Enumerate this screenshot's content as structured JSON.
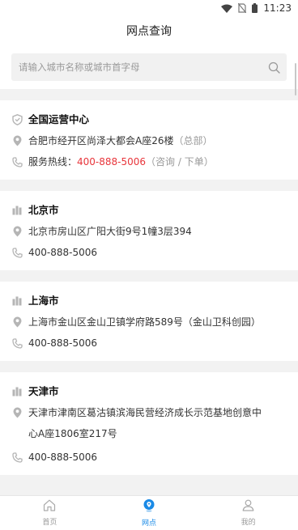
{
  "status_bar": {
    "time": "11:23",
    "icons": [
      "wifi-icon",
      "no-sim-icon",
      "battery-icon"
    ]
  },
  "header": {
    "title": "网点查询"
  },
  "search": {
    "placeholder": "请输入城市名称或城市首字母",
    "value": ""
  },
  "hq": {
    "title": "全国运营中心",
    "address": "合肥市经开区尚泽大都会A座26楼",
    "address_note": "（总部）",
    "hotline_label": "服务热线：",
    "hotline_number": "400-888-5006",
    "hotline_note": "（咨询 / 下单）"
  },
  "branches": [
    {
      "city": "北京市",
      "address": "北京市房山区广阳大街9号1幢3层394",
      "phone": "400-888-5006"
    },
    {
      "city": "上海市",
      "address": "上海市金山区金山卫镇学府路589号（金山卫科创园）",
      "phone": "400-888-5006"
    },
    {
      "city": "天津市",
      "address_line1": "天津市津南区葛沽镇滨海民营经济成长示范基地创意中",
      "address_line2": "心A座1806室217号",
      "phone": "400-888-5006"
    }
  ],
  "tab_bar": {
    "tabs": [
      {
        "label": "首页",
        "icon": "home-icon",
        "active": false
      },
      {
        "label": "网点",
        "icon": "location-pin-icon",
        "active": true
      },
      {
        "label": "我的",
        "icon": "user-icon",
        "active": false
      }
    ]
  },
  "colors": {
    "accent": "#1a8ae6",
    "hotline": "#e8353b",
    "icon_gray": "#b5b5b5"
  }
}
